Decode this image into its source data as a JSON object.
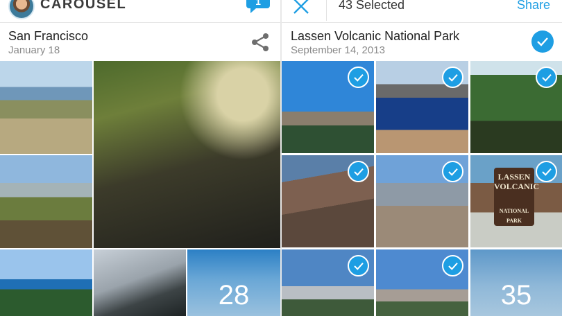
{
  "left": {
    "brand": "CAROUSEL",
    "message_count": "1",
    "day_title": "San Francisco",
    "day_date": "January 18",
    "more_count": "28"
  },
  "right": {
    "selected_label": "43 Selected",
    "share_label": "Share",
    "day_title": "Lassen Volcanic National Park",
    "day_date": "September 14, 2013",
    "more_count": "35",
    "sign_text": [
      "LASSEN",
      "VOLCANIC",
      "NATIONAL PARK"
    ]
  },
  "colors": {
    "accent": "#1e9ee3",
    "divider": "#e6e6e6",
    "date_gray": "#8a8a8a"
  },
  "icons": {
    "message": "chat-bubble-icon",
    "share": "share-icon",
    "close": "close-icon",
    "check": "checkmark-icon"
  }
}
